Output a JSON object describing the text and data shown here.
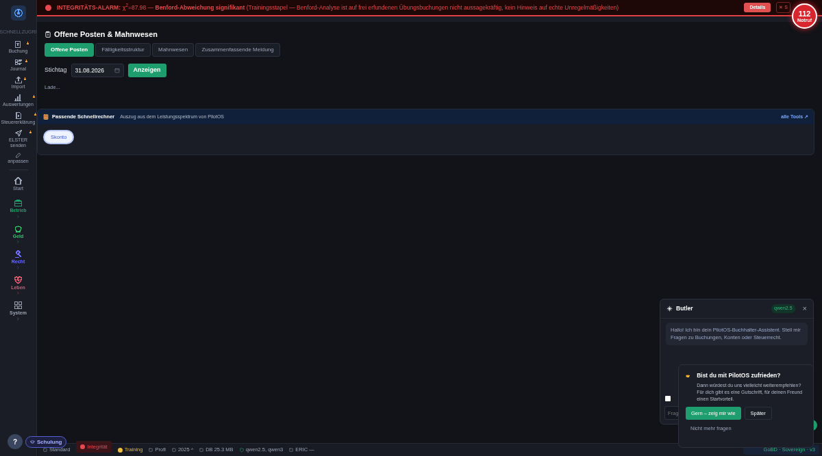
{
  "alarm": {
    "title": "INTEGRITÄTS-ALARM:",
    "message": "χ$^{2}$=87.98 — **Benford-Abweichung signifikant** (Trainingsstapel — Benford-Analyse ist auf frei erfundenen Übungsbuchungen nicht aussagekräftig, kein Hinweis auf echte Unregelmäßigkeiten)",
    "details_button": "Details",
    "close_button": "✕ S"
  },
  "emergency": {
    "number": "112",
    "label": "Notruf"
  },
  "sidebar": {
    "section_label": "SCHNELLZUGRI",
    "quick_items": [
      {
        "label": "Buchung",
        "starred": true
      },
      {
        "label": "Journal",
        "starred": true
      },
      {
        "label": "Import",
        "starred": true
      },
      {
        "label": "Auswertungen",
        "starred": true
      },
      {
        "label": "Steuererklärung",
        "starred": true
      },
      {
        "label": "ELSTER senden",
        "starred": true
      }
    ],
    "customize": "anpassen",
    "nav_items": [
      {
        "label": "Start",
        "kind": "link",
        "color": "#9aa3b5"
      },
      {
        "label": "Betrieb",
        "kind": "group",
        "color": "#22a06b"
      },
      {
        "label": "Geld",
        "kind": "group",
        "color": "#2fc46a"
      },
      {
        "label": "Recht",
        "kind": "group",
        "color": "#6b6bff"
      },
      {
        "label": "Leben",
        "kind": "group",
        "color": "#e5566e"
      },
      {
        "label": "System",
        "kind": "group",
        "color": "#9aa3b5"
      }
    ]
  },
  "page": {
    "title": "Offene Posten & Mahnwesen",
    "tabs": [
      {
        "label": "Offene Posten",
        "selected": true
      },
      {
        "label": "Fälligkeitsstruktur",
        "selected": false
      },
      {
        "label": "Mahnwesen",
        "selected": false
      },
      {
        "label": "Zusammenfassende Meldung",
        "selected": false
      }
    ],
    "date_label": "Stichtag",
    "date_value": "31.08.2026",
    "show_button": "Anzeigen",
    "loading": "Lade..."
  },
  "calculators": {
    "title": "Passende Schnellrechner",
    "subtitle": "Auszug aus dem Leistungsspektrum von PilotOS",
    "all_link": "alle Tools ↗",
    "chips": [
      "Skonto"
    ]
  },
  "butler": {
    "title": "Butler",
    "model": "qwen2.5",
    "close": "×",
    "message": "Hallo! Ich bin dein PilotOS-Buchhalter-Assistent. Stell mir Fragen zu Buchungen, Konten oder Steuerrecht.",
    "checkbox_checked": false,
    "input_placeholder": "Frag"
  },
  "survey": {
    "title": "Bist du mit PilotOS zufrieden?",
    "text": "Dann würdest du uns vielleicht weiterempfehlen? Für dich gibt es eine Gutschrift, für deinen Freund einen Startvorteil.",
    "primary": "Gern – zeig mir wie",
    "secondary": "Später",
    "dismiss": "Nicht mehr fragen"
  },
  "help_button": "?",
  "training_button": "Schulung",
  "status_bar": {
    "items": [
      {
        "kind": "plain",
        "text": "Standard"
      },
      {
        "kind": "alert",
        "text": "Integrität"
      },
      {
        "kind": "warn",
        "text": "Training"
      },
      {
        "kind": "plain",
        "text": "Profi"
      },
      {
        "kind": "plain",
        "text": "2025 ^"
      },
      {
        "kind": "plain",
        "text": "DB 25.3 MB"
      },
      {
        "kind": "ok",
        "text": "qwen2.5, qwen3"
      },
      {
        "kind": "plain",
        "text": "ERIC —"
      }
    ],
    "right": "GoBD · Sovereign · v3"
  }
}
